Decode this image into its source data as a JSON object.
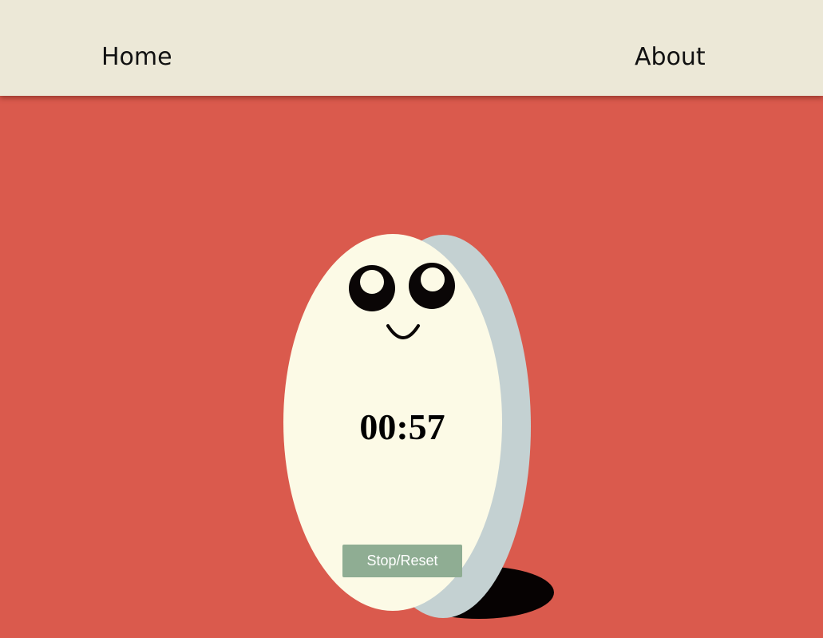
{
  "nav": {
    "home_label": "Home",
    "about_label": "About"
  },
  "timer": {
    "display": "00:57",
    "stop_reset_label": "Stop/Reset"
  },
  "colors": {
    "background": "#da5a4d",
    "navbar": "#ece8d7",
    "egg_face": "#fcfae6",
    "egg_side": "#c4d1d2",
    "shadow": "#060202",
    "button": "#8fad93"
  }
}
